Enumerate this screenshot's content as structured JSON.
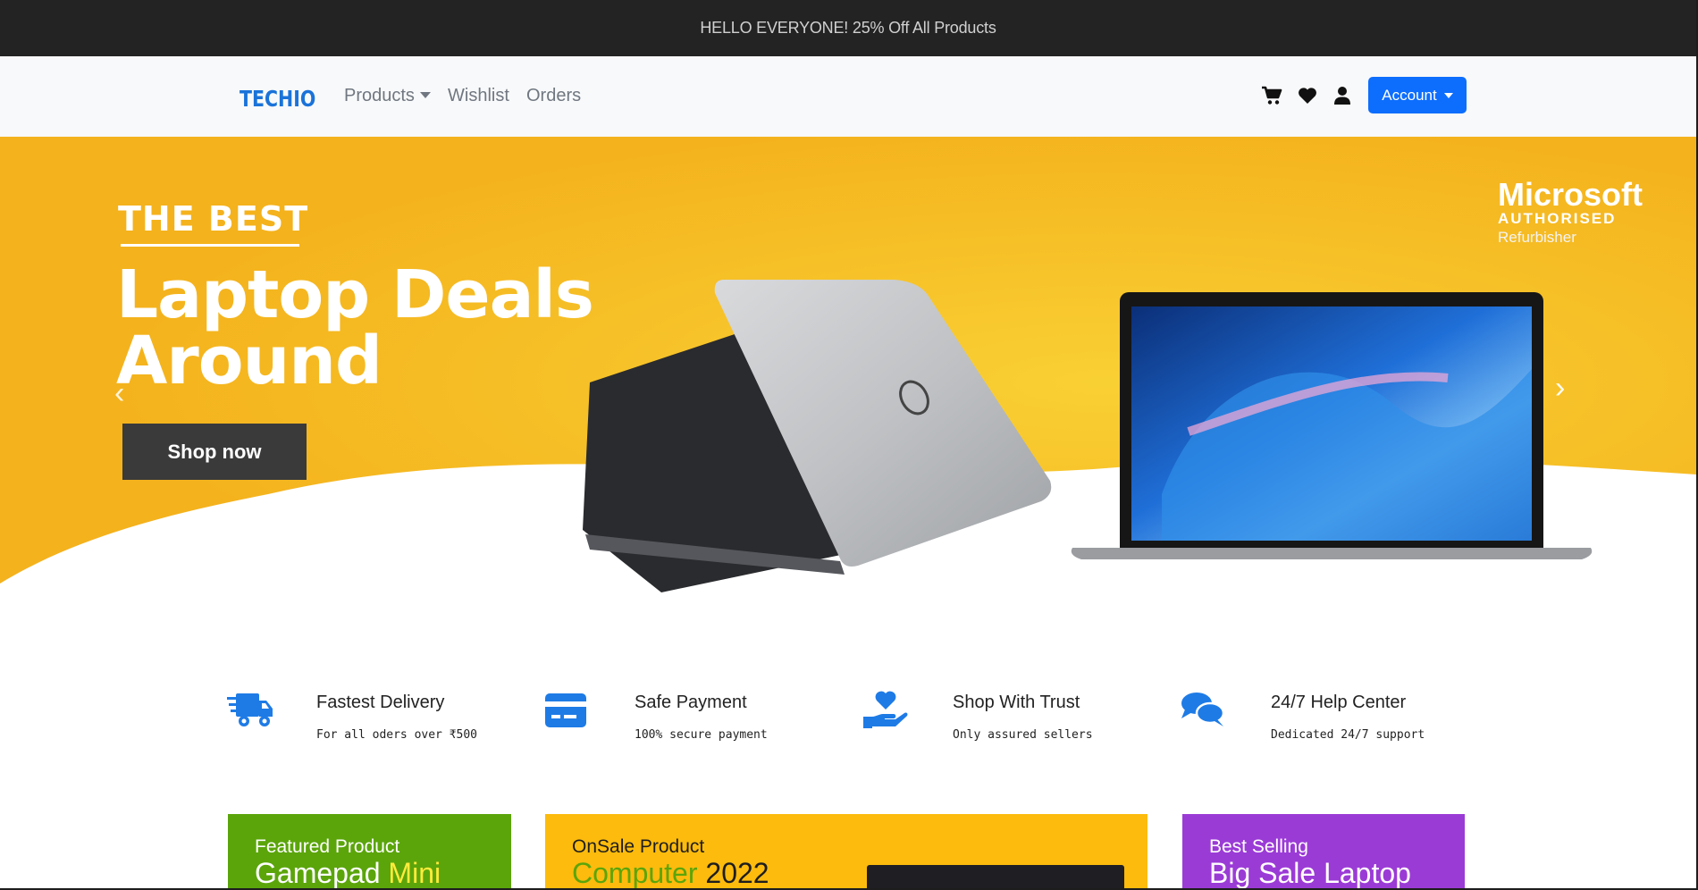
{
  "announcement": "HELLO EVERYONE! 25% Off All Products",
  "navbar": {
    "brand": "TECHIO",
    "links": {
      "products": "Products",
      "wishlist": "Wishlist",
      "orders": "Orders"
    },
    "icons": [
      "cart-icon",
      "heart-icon",
      "user-icon"
    ],
    "account_label": "Account"
  },
  "hero": {
    "kicker": "THE BEST",
    "headline_line1": "Laptop Deals",
    "headline_line2": "Around",
    "cta": "Shop now",
    "badge": {
      "name": "Microsoft",
      "line2": "AUTHORISED",
      "line3": "Refurbisher"
    },
    "colors": {
      "yellow": "#f6b81f",
      "button": "#3a3a3a"
    }
  },
  "features": [
    {
      "icon": "truck-icon",
      "title": "Fastest Delivery",
      "subtitle": "For all oders over ₹500"
    },
    {
      "icon": "credit-card-icon",
      "title": "Safe Payment",
      "subtitle": "100% secure payment"
    },
    {
      "icon": "hand-heart-icon",
      "title": "Shop With Trust",
      "subtitle": "Only assured sellers"
    },
    {
      "icon": "chat-icon",
      "title": "24/7 Help Center",
      "subtitle": "Dedicated 24/7 support"
    }
  ],
  "promos": [
    {
      "title": "Featured Product",
      "name_part1": "Gamepad",
      "name_part2": "Mini",
      "color": "#5ba50b"
    },
    {
      "title": "OnSale Product",
      "name_part1": "Computer",
      "name_part2": "2022",
      "color": "#fcbb0d"
    },
    {
      "title": "Best Selling",
      "name": "Big Sale Laptop",
      "color": "#9b3bd6"
    }
  ]
}
